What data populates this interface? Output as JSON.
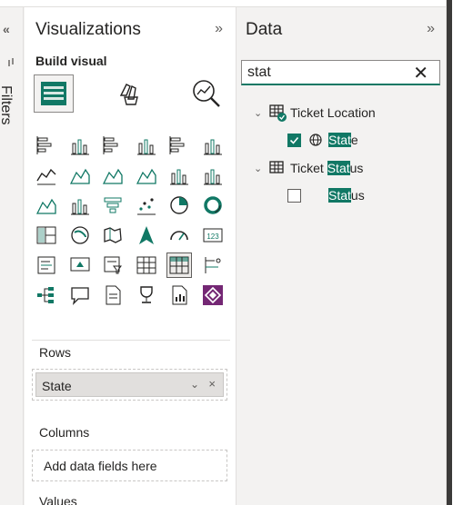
{
  "filters": {
    "label": "Filters",
    "expand_glyph": "«"
  },
  "visualizations": {
    "title": "Visualizations",
    "collapse_glyph": "»",
    "build_label": "Build visual",
    "modes": [
      "build-visual-icon",
      "format-visual-icon",
      "analytics-icon"
    ],
    "icons": [
      [
        "stacked-bar-chart-icon",
        "stacked-column-chart-icon",
        "clustered-bar-chart-icon",
        "clustered-column-chart-icon",
        "100-stacked-bar-chart-icon",
        "100-stacked-column-chart-icon"
      ],
      [
        "line-chart-icon",
        "area-chart-icon",
        "stacked-area-chart-icon",
        "100-stacked-area-chart-icon",
        "line-and-stacked-column-chart-icon",
        "line-and-clustered-column-chart-icon"
      ],
      [
        "ribbon-chart-icon",
        "waterfall-chart-icon",
        "funnel-chart-icon",
        "scatter-chart-icon",
        "pie-chart-icon",
        "donut-chart-icon"
      ],
      [
        "treemap-icon",
        "map-icon",
        "filled-map-icon",
        "azure-map-icon",
        "gauge-icon",
        "card-icon"
      ],
      [
        "multi-row-card-icon",
        "kpi-icon",
        "slicer-icon",
        "table-icon",
        "matrix-icon",
        "key-influencers-icon"
      ],
      [
        "decomposition-tree-icon",
        "qa-icon",
        "smart-narrative-icon",
        "metrics-icon",
        "paginated-report-icon",
        "power-apps-icon"
      ]
    ],
    "selected_icon": "matrix-icon",
    "wells": {
      "rows_label": "Rows",
      "rows_field": "State",
      "columns_label": "Columns",
      "columns_placeholder": "Add data fields here",
      "values_label": "Values"
    }
  },
  "data_pane": {
    "title": "Data",
    "collapse_glyph": "»",
    "search_value": "stat",
    "clear_glyph": "✕",
    "tree": [
      {
        "table": "Ticket Location",
        "fields": [
          {
            "pre": "",
            "match": "Stat",
            "post": "e",
            "checked": true,
            "geo": true
          }
        ]
      },
      {
        "table_pre": "Ticket ",
        "table_match": "Stat",
        "table_post": "us",
        "fields": [
          {
            "pre": "",
            "match": "Stat",
            "post": "us",
            "checked": false,
            "geo": false
          }
        ]
      }
    ]
  },
  "colors": {
    "accent": "#117865",
    "pane_bg": "#f3f2f1",
    "viz_bg": "#ffffff",
    "power_apps": "#742774"
  }
}
